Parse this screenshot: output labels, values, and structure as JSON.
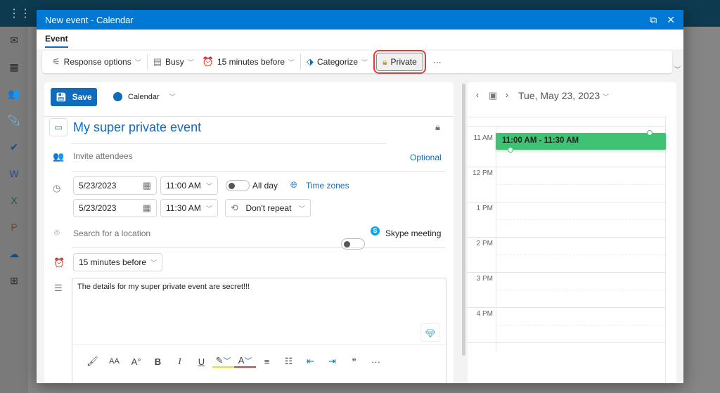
{
  "window": {
    "title": "New event - Calendar"
  },
  "tabs": [
    {
      "label": "Event"
    }
  ],
  "toolbar": {
    "response_options": "Response options",
    "busy": "Busy",
    "reminder": "15 minutes before",
    "categorize": "Categorize",
    "private": "Private",
    "more": "···"
  },
  "form": {
    "save": "Save",
    "calendar": "Calendar",
    "calendar_color": "#0f6cbd",
    "title": "My super private event",
    "attendees_placeholder": "Invite attendees",
    "optional": "Optional",
    "start_date": "5/23/2023",
    "start_time": "11:00 AM",
    "end_date": "5/23/2023",
    "end_time": "11:30 AM",
    "all_day": "All day",
    "time_zones": "Time zones",
    "repeat": "Don't repeat",
    "location_placeholder": "Search for a location",
    "skype": "Skype meeting",
    "reminder": "15 minutes before",
    "body": "The details for my super private event are secret!!!"
  },
  "calendar": {
    "date": "Tue, May 23, 2023",
    "hours": [
      "11 AM",
      "12 PM",
      "1 PM",
      "2 PM",
      "3 PM",
      "4 PM"
    ],
    "event": "11:00 AM - 11:30 AM",
    "event_color": "#40c274"
  }
}
